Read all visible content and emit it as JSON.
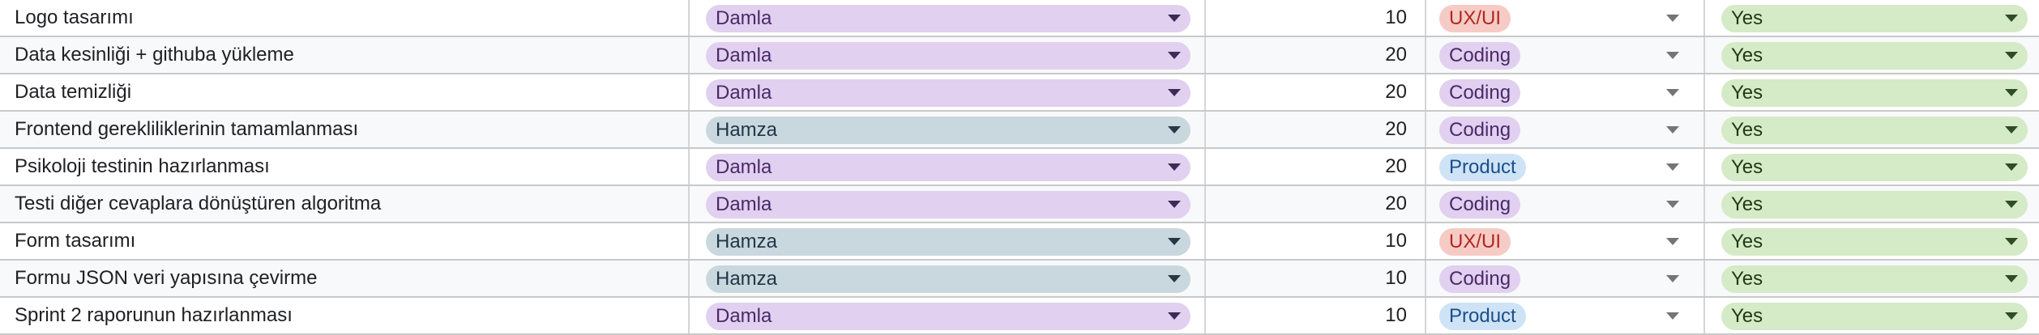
{
  "rows": [
    {
      "task": "Logo tasarımı",
      "owner": "Damla",
      "points": "10",
      "category": "UX/UI",
      "done": "Yes"
    },
    {
      "task": "Data kesinliği + githuba yükleme",
      "owner": "Damla",
      "points": "20",
      "category": "Coding",
      "done": "Yes"
    },
    {
      "task": "Data temizliği",
      "owner": "Damla",
      "points": "20",
      "category": "Coding",
      "done": "Yes"
    },
    {
      "task": "Frontend gerekliliklerinin tamamlanması",
      "owner": "Hamza",
      "points": "20",
      "category": "Coding",
      "done": "Yes"
    },
    {
      "task": "Psikoloji testinin hazırlanması",
      "owner": "Damla",
      "points": "20",
      "category": "Product",
      "done": "Yes"
    },
    {
      "task": "Testi diğer cevaplara dönüştüren algoritma",
      "owner": "Damla",
      "points": "20",
      "category": "Coding",
      "done": "Yes"
    },
    {
      "task": "Form tasarımı",
      "owner": "Hamza",
      "points": "10",
      "category": "UX/UI",
      "done": "Yes"
    },
    {
      "task": "Formu JSON veri yapısına çevirme",
      "owner": "Hamza",
      "points": "10",
      "category": "Coding",
      "done": "Yes"
    },
    {
      "task": "Sprint 2 raporunun hazırlanması",
      "owner": "Damla",
      "points": "10",
      "category": "Product",
      "done": "Yes"
    }
  ],
  "colors": {
    "owner_damla": "#e1d0ef",
    "owner_hamza": "#c9d7de",
    "cat_uxui": "#f6cbc5",
    "cat_coding": "#e1d0ef",
    "cat_product": "#cfe3f6",
    "done_yes": "#d5eac7"
  },
  "icons": {
    "dropdown": "caret-down-icon"
  }
}
